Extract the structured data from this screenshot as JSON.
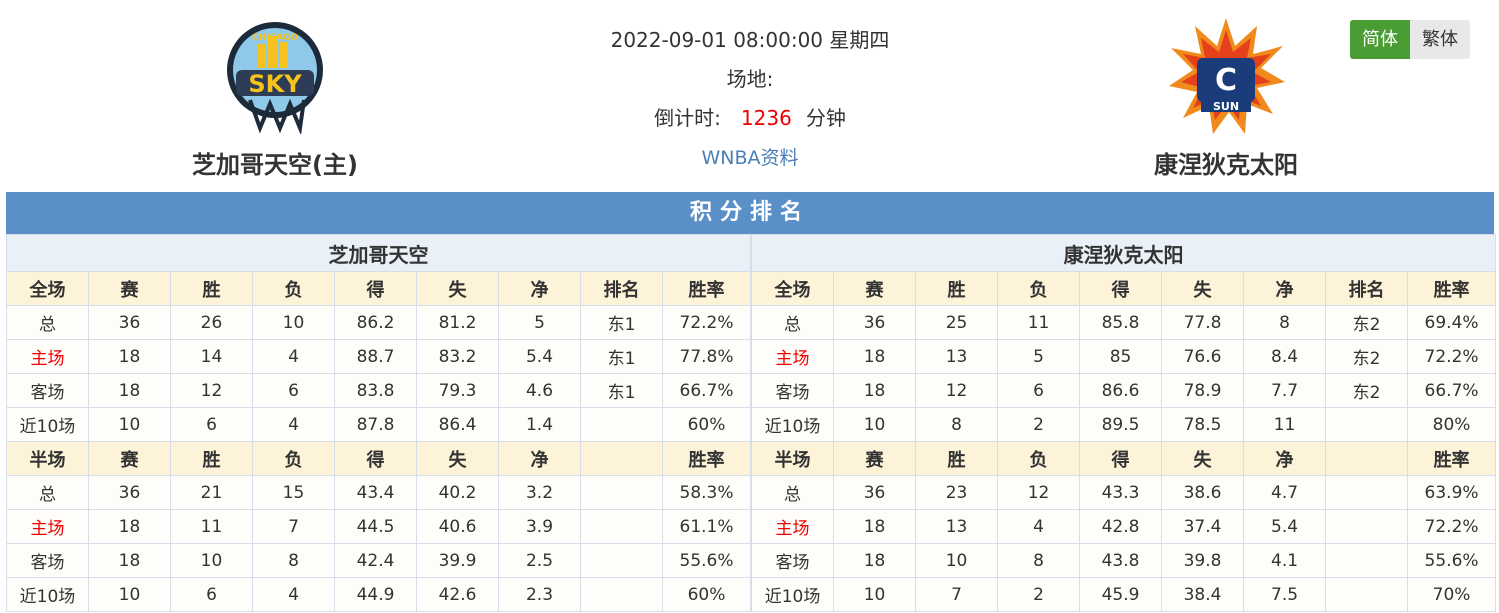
{
  "match": {
    "datetime": "2022-09-01 08:00:00 星期四",
    "venue_label": "场地:",
    "countdown_label": "倒计时:",
    "countdown_value": "1236",
    "countdown_unit": "分钟",
    "info_link": "WNBA资料"
  },
  "home_team": {
    "name": "芝加哥天空(主)",
    "short": "芝加哥天空"
  },
  "away_team": {
    "name": "康涅狄克太阳",
    "short": "康涅狄克太阳"
  },
  "lang": {
    "simplified": "简体",
    "traditional": "繁体"
  },
  "standings": {
    "title": "积分排名",
    "full_headers": [
      "全场",
      "赛",
      "胜",
      "负",
      "得",
      "失",
      "净",
      "排名",
      "胜率"
    ],
    "half_headers": [
      "半场",
      "赛",
      "胜",
      "负",
      "得",
      "失",
      "净",
      "",
      "胜率"
    ],
    "home": {
      "full": [
        [
          "总",
          "36",
          "26",
          "10",
          "86.2",
          "81.2",
          "5",
          "东1",
          "72.2%"
        ],
        [
          "主场",
          "18",
          "14",
          "4",
          "88.7",
          "83.2",
          "5.4",
          "东1",
          "77.8%"
        ],
        [
          "客场",
          "18",
          "12",
          "6",
          "83.8",
          "79.3",
          "4.6",
          "东1",
          "66.7%"
        ],
        [
          "近10场",
          "10",
          "6",
          "4",
          "87.8",
          "86.4",
          "1.4",
          "",
          "60%"
        ]
      ],
      "half": [
        [
          "总",
          "36",
          "21",
          "15",
          "43.4",
          "40.2",
          "3.2",
          "",
          "58.3%"
        ],
        [
          "主场",
          "18",
          "11",
          "7",
          "44.5",
          "40.6",
          "3.9",
          "",
          "61.1%"
        ],
        [
          "客场",
          "18",
          "10",
          "8",
          "42.4",
          "39.9",
          "2.5",
          "",
          "55.6%"
        ],
        [
          "近10场",
          "10",
          "6",
          "4",
          "44.9",
          "42.6",
          "2.3",
          "",
          "60%"
        ]
      ]
    },
    "away": {
      "full": [
        [
          "总",
          "36",
          "25",
          "11",
          "85.8",
          "77.8",
          "8",
          "东2",
          "69.4%"
        ],
        [
          "主场",
          "18",
          "13",
          "5",
          "85",
          "76.6",
          "8.4",
          "东2",
          "72.2%"
        ],
        [
          "客场",
          "18",
          "12",
          "6",
          "86.6",
          "78.9",
          "7.7",
          "东2",
          "66.7%"
        ],
        [
          "近10场",
          "10",
          "8",
          "2",
          "89.5",
          "78.5",
          "11",
          "",
          "80%"
        ]
      ],
      "half": [
        [
          "总",
          "36",
          "23",
          "12",
          "43.3",
          "38.6",
          "4.7",
          "",
          "63.9%"
        ],
        [
          "主场",
          "18",
          "13",
          "4",
          "42.8",
          "37.4",
          "5.4",
          "",
          "72.2%"
        ],
        [
          "客场",
          "18",
          "10",
          "8",
          "43.8",
          "39.8",
          "4.1",
          "",
          "55.6%"
        ],
        [
          "近10场",
          "10",
          "7",
          "2",
          "45.9",
          "38.4",
          "7.5",
          "",
          "70%"
        ]
      ]
    }
  },
  "logos": {
    "home_text": "SKY",
    "home_ring_text": "CHICAGO",
    "away_text": "C",
    "away_sub": "SUN"
  },
  "colors": {
    "accent_blue": "#5a8fc8",
    "active_green": "#4a9d33",
    "red": "#e00000"
  }
}
